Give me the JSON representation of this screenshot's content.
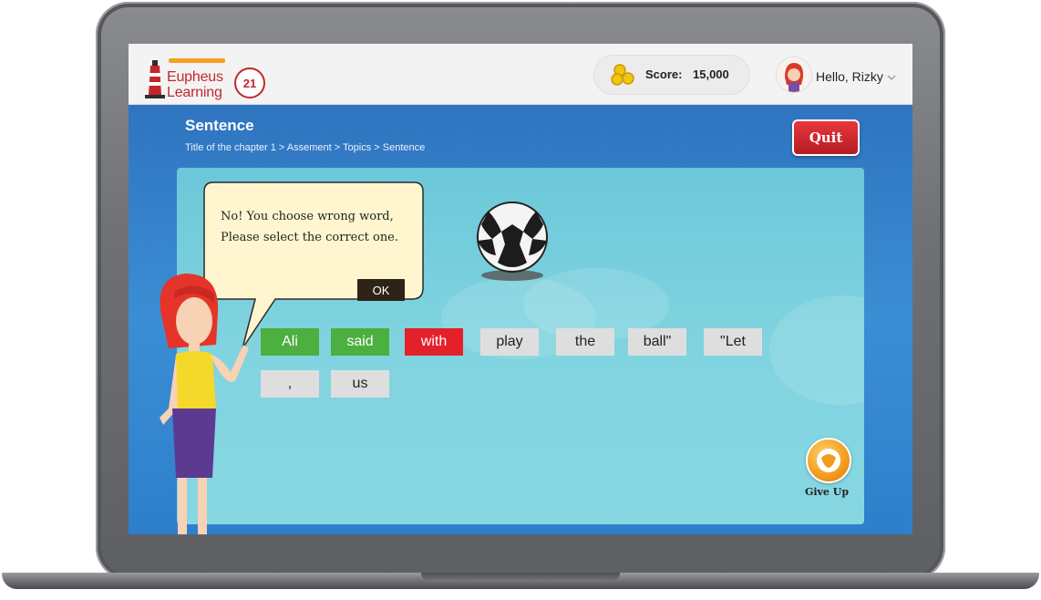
{
  "brand": {
    "line1": "Eupheus",
    "line2": "Learning",
    "badge": "21"
  },
  "score": {
    "label": "Score:",
    "value": "15,000"
  },
  "user": {
    "greeting": "Hello, Rizky"
  },
  "page": {
    "title": "Sentence",
    "breadcrumb": "Title of the chapter 1 > Assement > Topics > Sentence",
    "quit_label": "Quit"
  },
  "dialog": {
    "line1": "No! You choose wrong word,",
    "line2": "Please select the correct one.",
    "ok_label": "OK"
  },
  "words": [
    {
      "text": "Ali",
      "state": "correct"
    },
    {
      "text": "said",
      "state": "correct"
    },
    {
      "text": "with",
      "state": "wrong"
    },
    {
      "text": "play",
      "state": "idle"
    },
    {
      "text": "the",
      "state": "idle"
    },
    {
      "text": "ball\"",
      "state": "idle"
    },
    {
      "text": "\"Let",
      "state": "idle"
    },
    {
      "text": ",",
      "state": "idle"
    },
    {
      "text": "us",
      "state": "idle"
    }
  ],
  "give_up": {
    "label": "Give Up"
  },
  "colors": {
    "correct": "#4caf3f",
    "wrong": "#e4202a",
    "idle": "#dedede",
    "quit": "#d3262c",
    "board": "#7fd3df"
  }
}
